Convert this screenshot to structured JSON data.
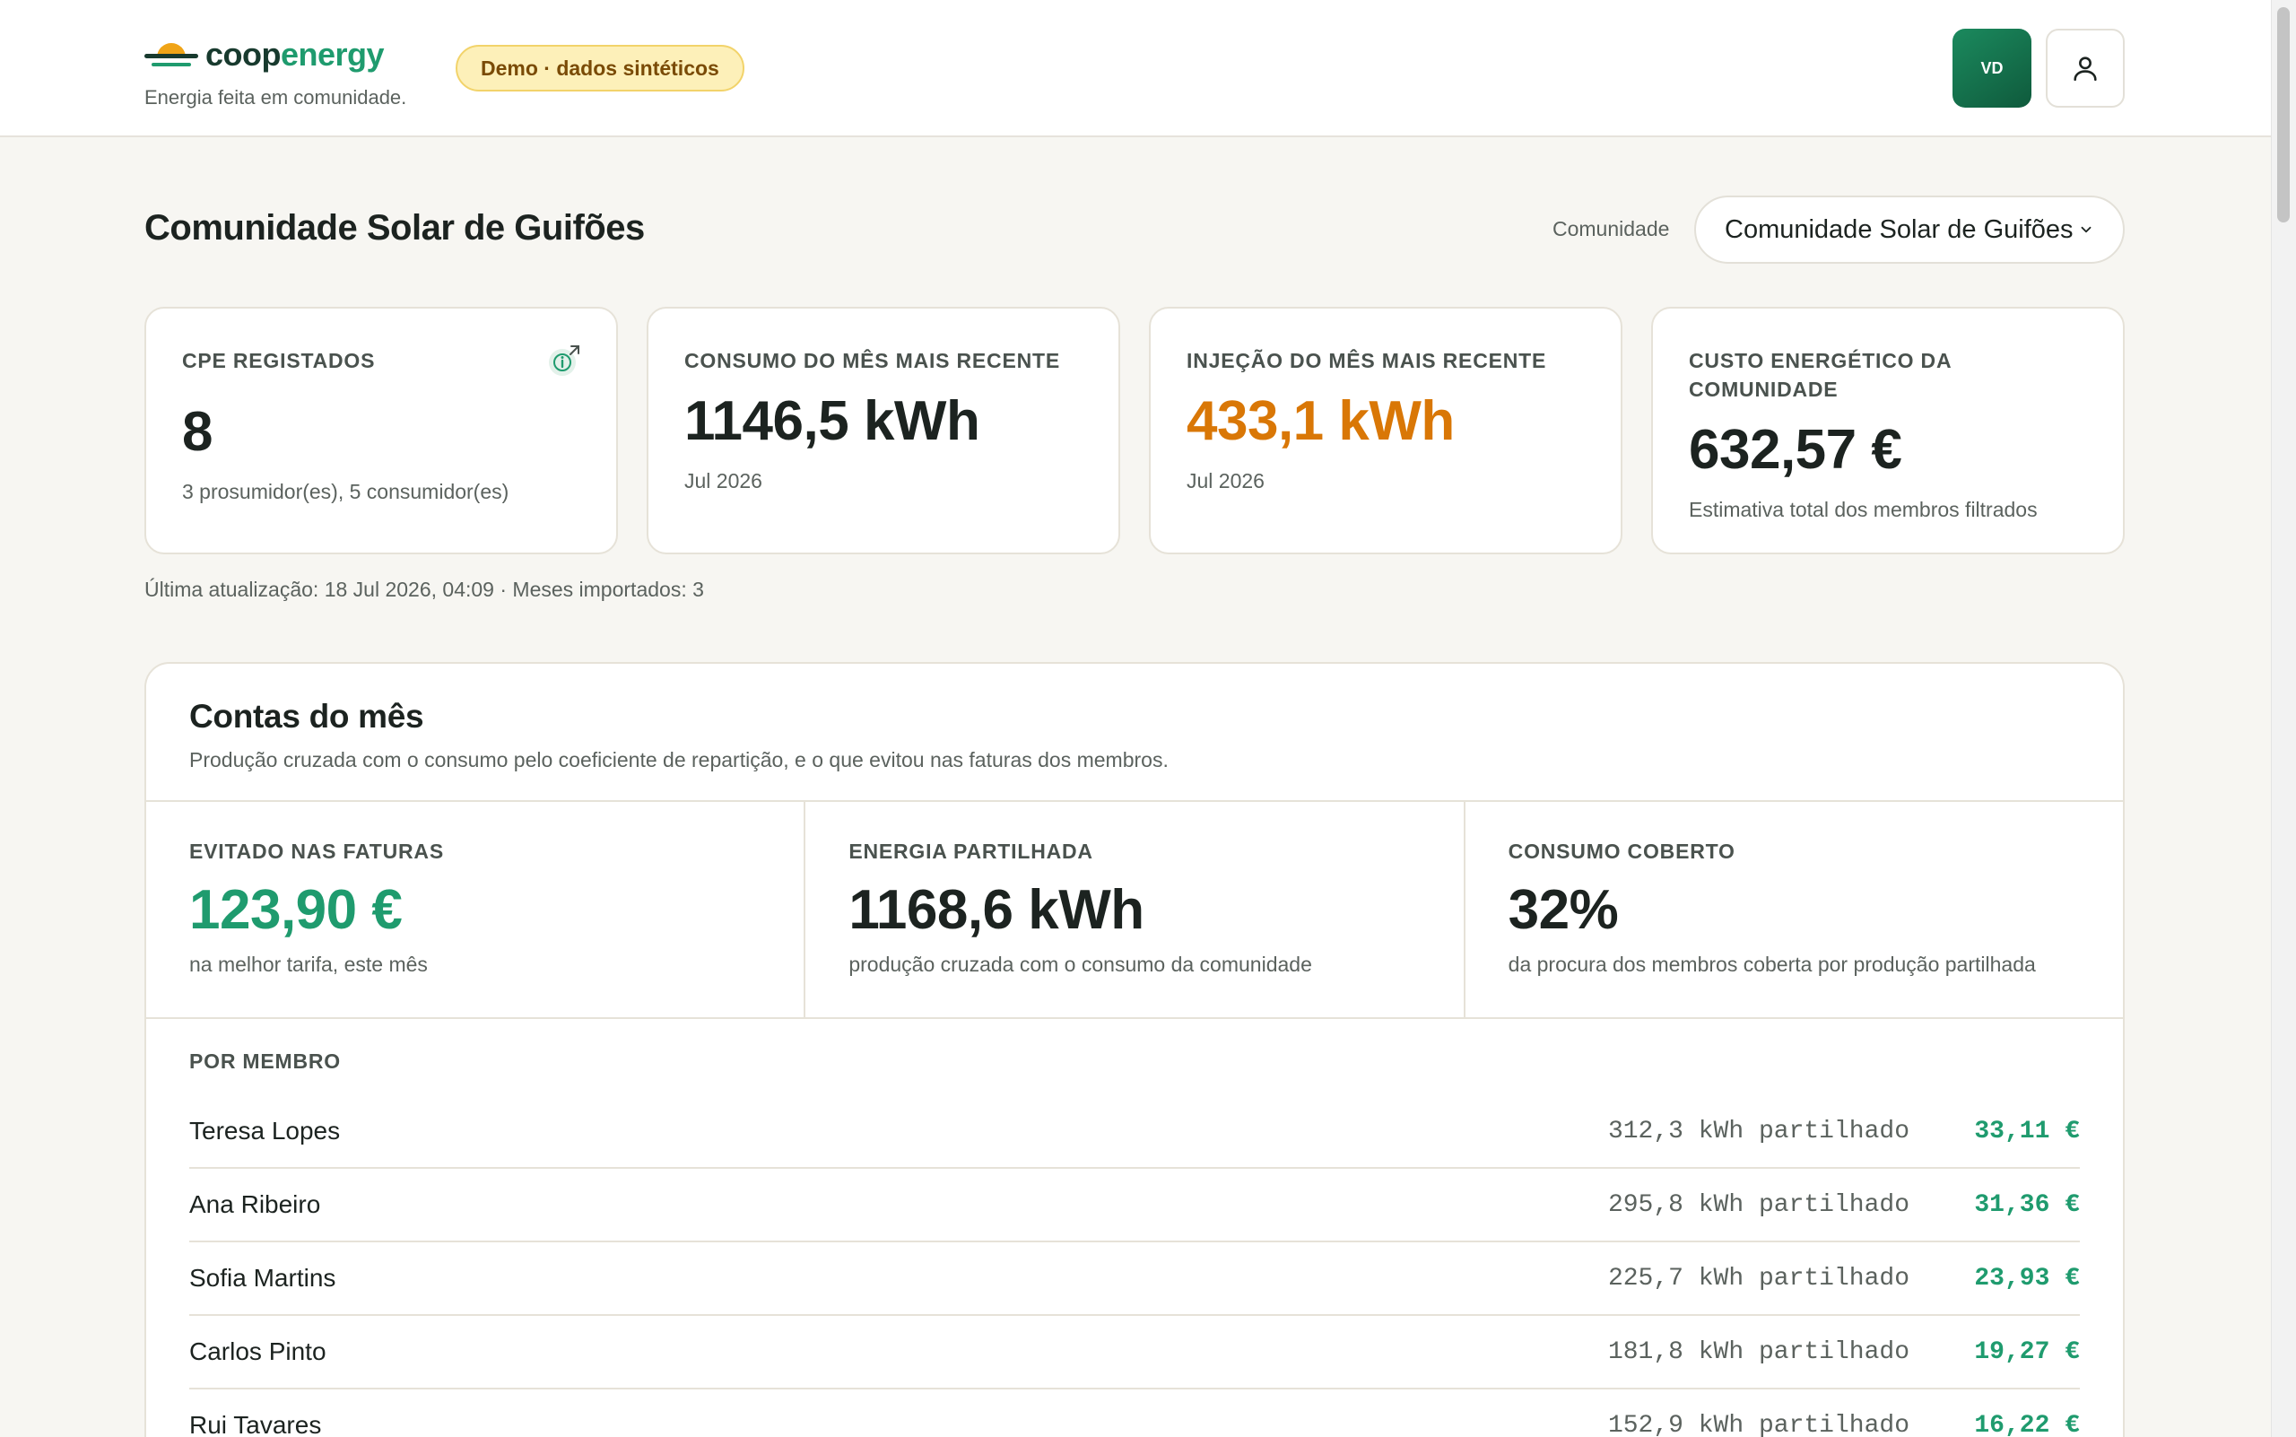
{
  "header": {
    "logo_coop": "coop",
    "logo_energy": "energy",
    "tagline": "Energia feita em comunidade.",
    "demo_badge": "Demo · dados sintéticos",
    "avatar_initials": "VD",
    "user_icon": "user-icon"
  },
  "page": {
    "title": "Comunidade Solar de Guifões",
    "community_label": "Comunidade",
    "community_selected": "Comunidade Solar de Guifões",
    "updated": "Última atualização: 18 Jul 2026, 04:09 · Meses importados: 3"
  },
  "kpis": [
    {
      "label": "CPE REGISTADOS",
      "value": "8",
      "sub": "3 prosumidor(es), 5 consumidor(es)"
    },
    {
      "label": "CONSUMO DO MÊS MAIS RECENTE",
      "value": "1146,5 kWh",
      "sub": "Jul 2026"
    },
    {
      "label": "INJEÇÃO DO MÊS MAIS RECENTE",
      "value": "433,1 kWh",
      "sub": "Jul 2026"
    },
    {
      "label": "CUSTO ENERGÉTICO DA COMUNIDADE",
      "value": "632,57 €",
      "sub": "Estimativa total dos membros filtrados"
    }
  ],
  "accounts": {
    "title": "Contas do mês",
    "subtitle": "Produção cruzada com o consumo pelo coeficiente de repartição, e o que evitou nas faturas dos membros.",
    "metrics": [
      {
        "label": "EVITADO NAS FATURAS",
        "value": "123,90 €",
        "sub": "na melhor tarifa, este mês"
      },
      {
        "label": "ENERGIA PARTILHADA",
        "value": "1168,6 kWh",
        "sub": "produção cruzada com o consumo da comunidade"
      },
      {
        "label": "CONSUMO COBERTO",
        "value": "32%",
        "sub": "da procura dos membros coberta por produção partilhada"
      }
    ],
    "members_label": "POR MEMBRO",
    "members": [
      {
        "name": "Teresa Lopes",
        "kwh": "312,3 kWh partilhado",
        "eur": "33,11 €"
      },
      {
        "name": "Ana Ribeiro",
        "kwh": "295,8 kWh partilhado",
        "eur": "31,36 €"
      },
      {
        "name": "Sofia Martins",
        "kwh": "225,7 kWh partilhado",
        "eur": "23,93 €"
      },
      {
        "name": "Carlos Pinto",
        "kwh": "181,8 kWh partilhado",
        "eur": "19,27 €"
      },
      {
        "name": "Rui Tavares",
        "kwh": "152,9 kWh partilhado",
        "eur": "16,22 €"
      }
    ]
  },
  "colors": {
    "brand_green": "#1f9b6e",
    "brand_dark": "#183a2e",
    "accent_orange": "#d97706",
    "sun_yellow": "#f0a417"
  }
}
